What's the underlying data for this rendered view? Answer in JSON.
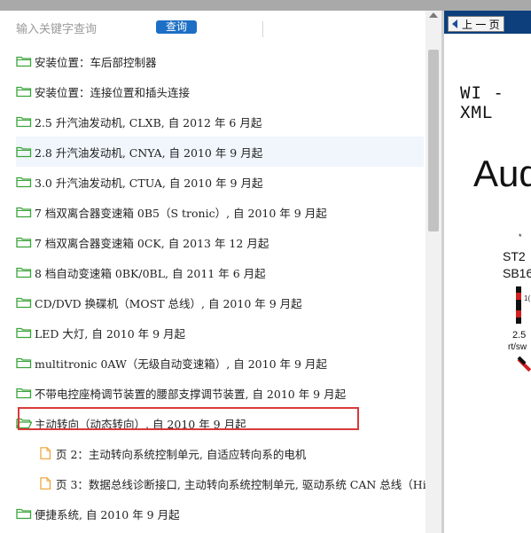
{
  "search": {
    "placeholder": "输入关键字查询",
    "button_label": "查询"
  },
  "tree": {
    "items": [
      {
        "type": "folder",
        "label": "安装位置：车后部控制器"
      },
      {
        "type": "folder",
        "label": "安装位置：连接位置和插头连接"
      },
      {
        "type": "folder",
        "label": "2.5 升汽油发动机, CLXB, 自 2012 年 6 月起"
      },
      {
        "type": "folder",
        "label": "2.8 升汽油发动机, CNYA, 自 2010 年 9 月起",
        "highlighted": true
      },
      {
        "type": "folder",
        "label": "3.0 升汽油发动机, CTUA, 自 2010 年 9 月起"
      },
      {
        "type": "folder",
        "label": "7 档双离合器变速箱 0B5（S tronic）, 自 2010 年 9 月起"
      },
      {
        "type": "folder",
        "label": "7 档双离合器变速箱 0CK, 自 2013 年 12 月起"
      },
      {
        "type": "folder",
        "label": "8 档自动变速箱 0BK/0BL, 自 2011 年 6 月起"
      },
      {
        "type": "folder",
        "label": "CD/DVD 换碟机（MOST 总线）, 自 2010 年 9 月起"
      },
      {
        "type": "folder",
        "label": "LED 大灯, 自 2010 年 9 月起"
      },
      {
        "type": "folder",
        "label": "multitronic 0AW（无级自动变速箱）, 自 2010 年 9 月起"
      },
      {
        "type": "folder",
        "label": "不带电控座椅调节装置的腰部支撑调节装置, 自 2010 年 9 月起"
      },
      {
        "type": "folder-open",
        "label": "主动转向（动态转向）, 自 2010 年 9 月起",
        "selected": true
      },
      {
        "type": "page",
        "label": "页 2：主动转向系统控制单元, 自适应转向系的电机"
      },
      {
        "type": "page",
        "label": "页 3：数据总线诊断接口, 主动转向系统控制单元, 驱动系统 CAN 总线（Hi"
      },
      {
        "type": "folder",
        "label": "便捷系统, 自 2010 年 9 月起"
      }
    ]
  },
  "viewer": {
    "prev_label": "上 一 页",
    "doc_code": "WI - XML",
    "brand": "Aud",
    "star": "*",
    "st2": "ST2",
    "sb16": "SB16",
    "tick": "1(",
    "gauge": "2.5",
    "wire_color": "rt/sw"
  },
  "colors": {
    "folder_green": "#3aa43a",
    "page_orange": "#f0a030",
    "button_blue": "#1c6fc4",
    "selection_red": "#d93a3a",
    "viewer_header": "#0d3f7c"
  }
}
